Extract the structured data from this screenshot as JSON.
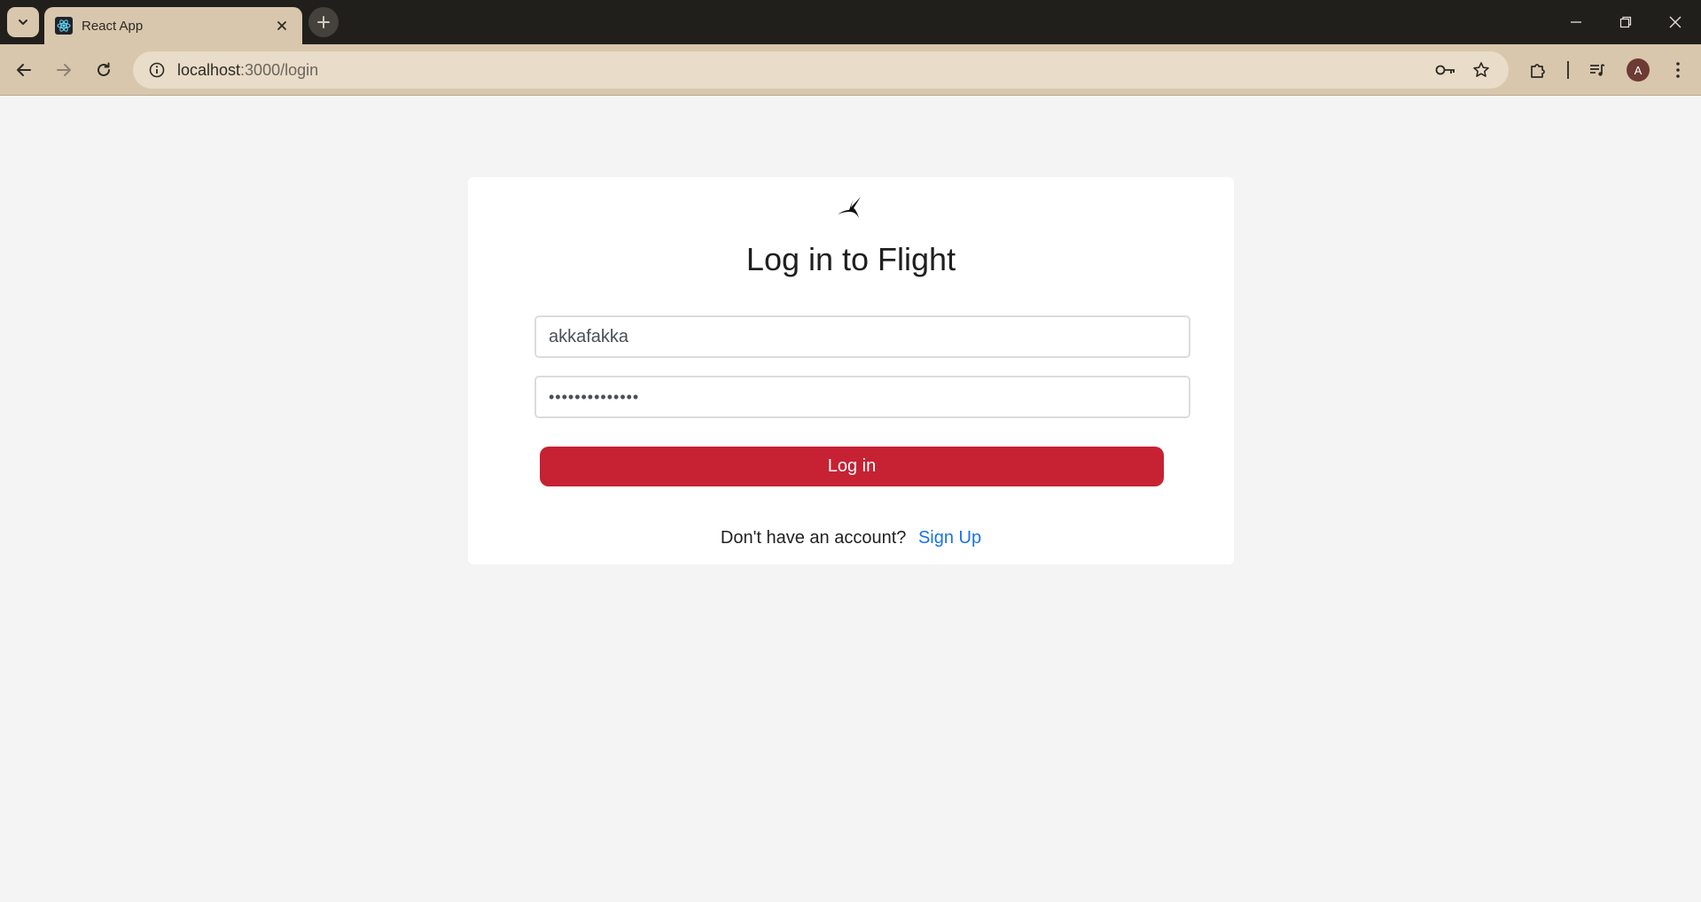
{
  "browser": {
    "tab_title": "React App",
    "url_host": "localhost",
    "url_path": ":3000/login",
    "profile_initial": "A"
  },
  "page": {
    "heading": "Log in to Flight",
    "username_value": "akkafakka",
    "password_value": "••••••••••••••",
    "login_button": "Log in",
    "signup_prompt": "Don't have an account?",
    "signup_link": "Sign Up"
  },
  "colors": {
    "primary_button": "#c62233",
    "link": "#1a73e8",
    "chrome": "#d9c7ad",
    "tabbar": "#211f1c",
    "page_bg": "#f4f4f4"
  },
  "icons": [
    "tab-list-icon",
    "react-favicon-icon",
    "close-icon",
    "plus-icon",
    "minimize-icon",
    "restore-icon",
    "window-close-icon",
    "back-arrow-icon",
    "forward-arrow-icon",
    "reload-icon",
    "site-info-icon",
    "password-key-icon",
    "star-icon",
    "extensions-icon",
    "media-control-icon",
    "menu-dots-icon",
    "flight-bird-logo"
  ]
}
